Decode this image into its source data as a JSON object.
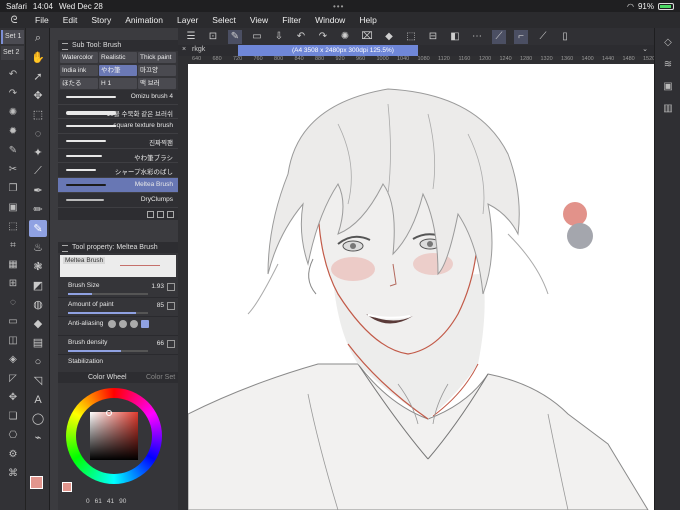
{
  "status": {
    "app": "Safari",
    "time": "14:04",
    "date": "Wed Dec 28",
    "battery": "91%",
    "battery_level": 0.91
  },
  "menu": [
    "File",
    "Edit",
    "Story",
    "Animation",
    "Layer",
    "Select",
    "View",
    "Filter",
    "Window",
    "Help"
  ],
  "sets": [
    "Set 1",
    "Set 2"
  ],
  "subtool": {
    "title": "Sub Tool: Brush",
    "groups_row1": [
      "Watercolor",
      "Realistic",
      "Thick paint"
    ],
    "groups_row2": [
      "India ink",
      "やわ筆",
      "마끄양"
    ],
    "groups_row3": [
      "ほたる",
      "H 1",
      "맥 브러"
    ],
    "brushes": [
      "Omizu brush 4",
      "10물 수묵화 같은 브러쉬",
      "square texture brush",
      "진짜찍팬",
      "やわ筆ブラシ",
      "シャープ水彩のばし",
      "Meltea Brush",
      "DryClumps"
    ],
    "selected": "Meltea Brush"
  },
  "property": {
    "title": "Tool property: Meltea Brush",
    "preview_label": "Meltea Brush",
    "brush_size_label": "Brush Size",
    "brush_size": "1.93",
    "brush_size_level": 0.3,
    "amount_label": "Amount of paint",
    "amount": "85",
    "amount_level": 0.85,
    "aa_label": "Anti-aliasing",
    "density_label": "Brush density",
    "density": "66",
    "density_level": 0.66,
    "stab_label": "Stabilization"
  },
  "colorwheel": {
    "title": "Color Wheel",
    "tab2": "Color Set",
    "values": [
      "0",
      "61",
      "41",
      "90"
    ]
  },
  "canvas": {
    "doc": "rkgk",
    "info": "(A4 3508 x 2480px 300dpi 125.5%)"
  },
  "ruler_ticks": [
    "640",
    "680",
    "720",
    "760",
    "800",
    "840",
    "880",
    "920",
    "960",
    "1000",
    "1040",
    "1080",
    "1120",
    "1160",
    "1200",
    "1240",
    "1280",
    "1320",
    "1360",
    "1400",
    "1440",
    "1480",
    "1520"
  ],
  "colors": {
    "accent": "#8fa1e2",
    "main_color": "#e2958d",
    "palette_pink": "#e2928a",
    "palette_gray": "#a4a6ad"
  }
}
